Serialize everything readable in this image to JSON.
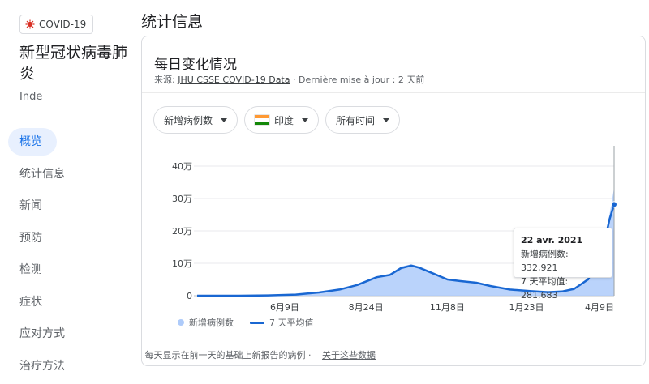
{
  "topic_chip": {
    "label": "COVID-19",
    "icon": "virus-icon"
  },
  "topic": {
    "title": "新型冠状病毒肺炎",
    "subtitle": "Inde"
  },
  "nav": {
    "items": [
      {
        "label": "概览",
        "active": true
      },
      {
        "label": "统计信息"
      },
      {
        "label": "新闻"
      },
      {
        "label": "预防"
      },
      {
        "label": "检测"
      },
      {
        "label": "症状"
      },
      {
        "label": "应对方式"
      },
      {
        "label": "治疗方法"
      }
    ]
  },
  "page_title": "统计信息",
  "card": {
    "title": "每日变化情况",
    "source_prefix": "来源:",
    "source_link": "JHU CSSE COVID-19 Data",
    "source_suffix": "· Dernière mise à jour : 2 天前",
    "filters": [
      {
        "label": "新增病例数"
      },
      {
        "label": "印度",
        "flag": [
          "#ff9933",
          "#ffffff",
          "#138808"
        ]
      },
      {
        "label": "所有时间"
      }
    ],
    "footnote": "每天显示在前一天的基础上新报告的病例 ·",
    "footnote_link": "关于这些数据"
  },
  "tooltip": {
    "date": "22 avr. 2021",
    "new_cases": "新增病例数: 332,921",
    "avg": "7 天平均值: 281,683"
  },
  "legend": {
    "daily": "新增病例数",
    "avg": "7 天平均值"
  },
  "colors": {
    "bars": "#aecbfa",
    "line": "#1967d2",
    "accent": "#1a73e8"
  },
  "chart_data": {
    "type": "area",
    "ylabel_ticks": [
      "0",
      "10万",
      "20万",
      "30万",
      "40万"
    ],
    "ylim": [
      0,
      400000
    ],
    "xticks": [
      "6月9日",
      "8月24日",
      "11月8日",
      "1月23日",
      "4月9日"
    ],
    "x": [
      "2020-01-30",
      "2020-03-15",
      "2020-04-15",
      "2020-05-15",
      "2020-06-09",
      "2020-07-01",
      "2020-07-20",
      "2020-08-10",
      "2020-08-24",
      "2020-09-05",
      "2020-09-16",
      "2020-09-25",
      "2020-10-10",
      "2020-10-25",
      "2020-11-08",
      "2020-11-25",
      "2020-12-10",
      "2020-12-31",
      "2021-01-23",
      "2021-02-10",
      "2021-02-25",
      "2021-03-10",
      "2021-03-25",
      "2021-04-09",
      "2021-04-17",
      "2021-04-22"
    ],
    "series": [
      {
        "name": "新增病例数",
        "values": [
          0,
          100,
          1000,
          4000,
          10000,
          20000,
          35000,
          60000,
          65000,
          90000,
          97000,
          90000,
          72000,
          52000,
          45000,
          42000,
          32000,
          20000,
          14000,
          11000,
          14000,
          23000,
          55000,
          145000,
          250000,
          332921
        ]
      },
      {
        "name": "7 天平均值",
        "values": [
          0,
          100,
          900,
          3500,
          10000,
          19000,
          33000,
          57000,
          64000,
          85000,
          93000,
          86000,
          68000,
          50000,
          45000,
          40000,
          30000,
          19000,
          14000,
          11000,
          13000,
          21000,
          50000,
          130000,
          235000,
          281683
        ]
      }
    ]
  }
}
